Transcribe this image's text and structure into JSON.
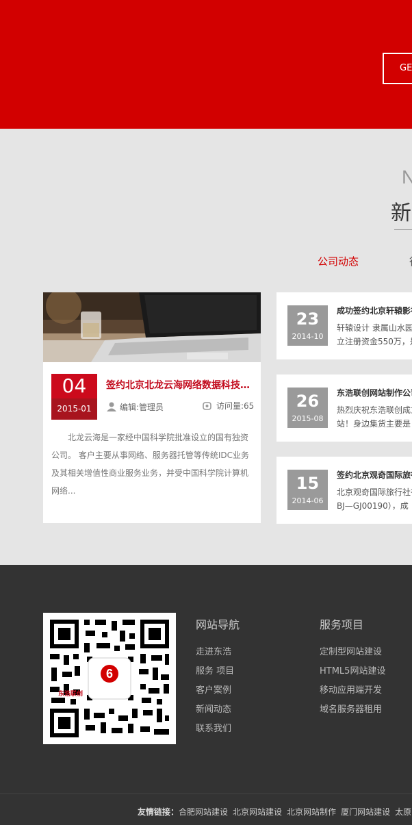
{
  "hero": {
    "button_label": "GE"
  },
  "news": {
    "heading_en": "N",
    "heading_cn": "新",
    "tabs": [
      "公司动态",
      "行"
    ],
    "featured": {
      "day": "04",
      "year_month": "2015-01",
      "title": "签约北京北龙云海网络数据科技有限公司",
      "editor": "编辑:管理员",
      "views": "访问量:65",
      "desc": "北龙云海是一家经中国科学院批准设立的国有独资公司。 客户主要从事网络、服务器托管等传统IDC业务及其相关增值性商业服务业务，并受中国科学院计算机网络..."
    },
    "items": [
      {
        "day": "23",
        "year_month": "2014-10",
        "title": "成功签约北京轩辕影视",
        "line1": "轩辕设计 隶属山水园",
        "line2": "立注册资金550万，是"
      },
      {
        "day": "26",
        "year_month": "2015-08",
        "title": "东浩联创网站制作公司",
        "line1": "热烈庆祝东浩联创成立",
        "line2": "站！身边集货主要是"
      },
      {
        "day": "15",
        "year_month": "2014-06",
        "title": "签约北京观奇国际旅行",
        "line1": "北京观奇国际旅行社有",
        "line2": "BJ—GJ00190），成"
      }
    ]
  },
  "footer": {
    "qr_logo_text": "东浩联创",
    "nav_title": "网站导航",
    "nav_links": [
      "走进东浩",
      "服务 项目",
      "客户案例",
      "新闻动态",
      "联系我们"
    ],
    "service_title": "服务项目",
    "service_links": [
      "定制型网站建设",
      "HTML5网站建设",
      "移动应用端开发",
      "域名服务器租用"
    ],
    "friends_label": "友情链接：",
    "friend_links": [
      "合肥网站建设",
      "北京网站建设",
      "北京网站制作",
      "厦门网站建设",
      "太原"
    ]
  },
  "colors": {
    "brand_red": "#d20000",
    "footer_bg": "#333333",
    "section_bg": "#e5e5e5"
  }
}
